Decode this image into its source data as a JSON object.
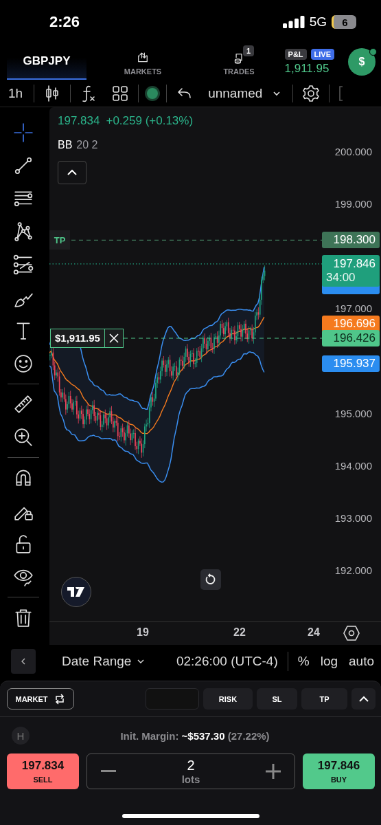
{
  "status_bar": {
    "time": "2:26",
    "network": "5G",
    "battery": "6"
  },
  "nav": {
    "tabs": [
      {
        "label": "GBPJPY",
        "selected": true
      },
      {
        "label": "MARKETS",
        "selected": false
      },
      {
        "label": "TRADES",
        "selected": false,
        "badge": "1"
      }
    ],
    "pnl": {
      "label": "P&L",
      "live": "LIVE",
      "value": "1,911.95"
    },
    "account_button": "$"
  },
  "toolbar": {
    "interval": "1h",
    "layout_name": "unnamed"
  },
  "chart": {
    "legend": {
      "price": "197.834",
      "change": "+0.259 (+0.13%)"
    },
    "indicator": {
      "name": "BB",
      "params": "20 2"
    },
    "price_axis": [
      "200.000",
      "199.000",
      "197.000",
      "195.000",
      "194.000",
      "193.000",
      "192.000"
    ],
    "price_tags": [
      {
        "value": "198.300",
        "color": "#3e7457"
      },
      {
        "value": "196.696",
        "color": "#f57a1e"
      },
      {
        "value": "196.426",
        "color": "#4fc68a"
      },
      {
        "value": "195.937",
        "color": "#2b8df0"
      }
    ],
    "last_price": {
      "value": "197.846",
      "countdown": "34:00"
    },
    "tp_label": "TP",
    "position": {
      "pnl": "$1,911.95"
    },
    "time_axis": [
      "19",
      "22",
      "24"
    ]
  },
  "bottom_bar": {
    "date_range": "Date Range",
    "time": "02:26:00 (UTC-4)",
    "options": [
      "%",
      "log",
      "auto"
    ]
  },
  "order_panel": {
    "order_type": "MARKET",
    "buttons": [
      "RISK",
      "SL",
      "TP"
    ],
    "hedge": "H",
    "margin": "Init. Margin: **~$537.30** (27.22%)",
    "sell": {
      "price": "197.834",
      "label": "SELL"
    },
    "lots": {
      "value": "2",
      "unit": "lots"
    },
    "buy": {
      "price": "197.846",
      "label": "BUY"
    }
  }
}
